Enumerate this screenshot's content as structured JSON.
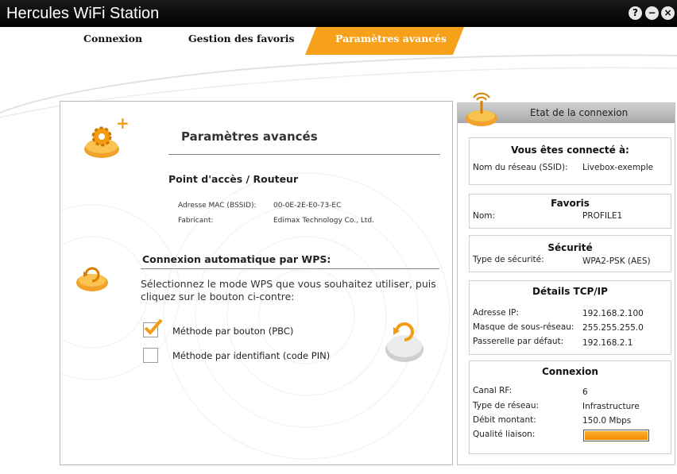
{
  "app": {
    "title": "Hercules WiFi Station"
  },
  "window_buttons": {
    "help": "?",
    "minimize": "−",
    "close": "×"
  },
  "tabs": [
    {
      "label": "Connexion",
      "active": false
    },
    {
      "label": "Gestion des favoris",
      "active": false
    },
    {
      "label": "Paramètres avancés",
      "active": true
    }
  ],
  "colors": {
    "accent": "#f7a11a",
    "titlebar": "#000000"
  },
  "main": {
    "title": "Paramètres avancés",
    "access_point": {
      "heading": "Point d'accès / Routeur",
      "mac_label": "Adresse MAC (BSSID):",
      "mac_value": "00-0E-2E-E0-73-EC",
      "vendor_label": "Fabricant:",
      "vendor_value": "Edimax Technology Co., Ltd."
    },
    "wps": {
      "heading": "Connexion automatique par WPS:",
      "instruction": "Sélectionnez le mode WPS que vous souhaitez utiliser, puis cliquez sur le bouton ci-contre:",
      "options": [
        {
          "label": "Méthode par bouton (PBC)",
          "checked": true
        },
        {
          "label": "Méthode par identifiant (code PIN)",
          "checked": false
        }
      ]
    }
  },
  "status_panel": {
    "title": "Etat de la connexion",
    "connected": {
      "heading": "Vous êtes connecté à:",
      "ssid_label": "Nom du réseau (SSID):",
      "ssid_value": "Livebox-exemple"
    },
    "favorites": {
      "heading": "Favoris",
      "name_label": "Nom:",
      "name_value": "PROFILE1"
    },
    "security": {
      "heading": "Sécurité",
      "type_label": "Type de sécurité:",
      "type_value": "WPA2-PSK (AES)"
    },
    "tcpip": {
      "heading": "Détails TCP/IP",
      "ip_label": "Adresse IP:",
      "ip_value": "192.168.2.100",
      "mask_label": "Masque de sous-réseau:",
      "mask_value": "255.255.255.0",
      "gateway_label": "Passerelle par défaut:",
      "gateway_value": "192.168.2.1"
    },
    "connection": {
      "heading": "Connexion",
      "channel_label": "Canal RF:",
      "channel_value": "6",
      "network_type_label": "Type de réseau:",
      "network_type_value": "Infrastructure",
      "rate_label": "Débit montant:",
      "rate_value": "150.0 Mbps",
      "quality_label": "Qualité liaison:",
      "quality_fraction": 1.0
    }
  }
}
